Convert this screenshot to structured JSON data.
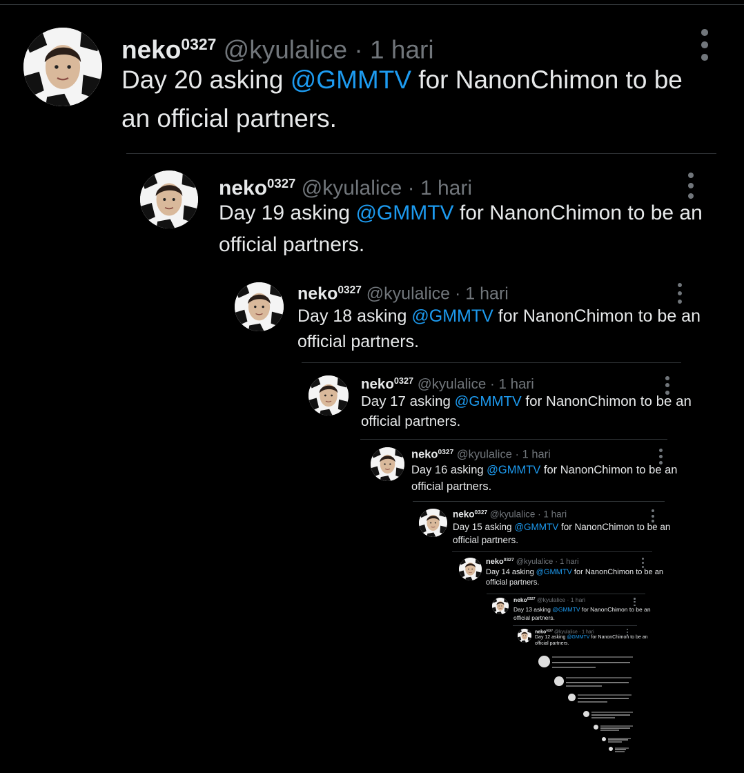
{
  "tweets": [
    {
      "name": "neko",
      "sup": "0327",
      "handle": "@kyulalice",
      "sep": "·",
      "time": "1 hari",
      "pre": "Day 20 asking ",
      "mention": "@GMMTV",
      "post": " for NanonChimon to be an official partners."
    },
    {
      "name": "neko",
      "sup": "0327",
      "handle": "@kyulalice",
      "sep": "·",
      "time": "1 hari",
      "pre": "Day 19 asking ",
      "mention": "@GMMTV",
      "post": " for NanonChimon to be an official partners."
    },
    {
      "name": "neko",
      "sup": "0327",
      "handle": "@kyulalice",
      "sep": "·",
      "time": "1 hari",
      "pre": "Day 18 asking ",
      "mention": "@GMMTV",
      "post": " for NanonChimon to be an official partners."
    },
    {
      "name": "neko",
      "sup": "0327",
      "handle": "@kyulalice",
      "sep": "·",
      "time": "1 hari",
      "pre": "Day 17 asking ",
      "mention": "@GMMTV",
      "post": " for NanonChimon to be an official partners."
    },
    {
      "name": "neko",
      "sup": "0327",
      "handle": "@kyulalice",
      "sep": "·",
      "time": "1 hari",
      "pre": "Day 16 asking ",
      "mention": "@GMMTV",
      "post": " for NanonChimon to be an official partners."
    },
    {
      "name": "neko",
      "sup": "0327",
      "handle": "@kyulalice",
      "sep": "·",
      "time": "1 hari",
      "pre": "Day 15 asking ",
      "mention": "@GMMTV",
      "post": " for NanonChimon to be an official partners."
    },
    {
      "name": "neko",
      "sup": "0327",
      "handle": "@kyulalice",
      "sep": "·",
      "time": "1 hari",
      "pre": "Day 14 asking ",
      "mention": "@GMMTV",
      "post": " for NanonChimon to be an official partners."
    },
    {
      "name": "neko",
      "sup": "0327",
      "handle": "@kyulalice",
      "sep": "·",
      "time": "1 hari",
      "pre": "Day 13 asking ",
      "mention": "@GMMTV",
      "post": " for NanonChimon to be an official partners."
    },
    {
      "name": "neko",
      "sup": "0327",
      "handle": "@kyulalice",
      "sep": "·",
      "time": "1 hari",
      "pre": "Day 12 asking ",
      "mention": "@GMMTV",
      "post": " for NanonChimon to be an official partners."
    }
  ],
  "icons": {
    "avatar": "avatar-image",
    "more": "more-options-icon"
  },
  "colors": {
    "background": "#000000",
    "text": "#e7e9ea",
    "muted": "#71767b",
    "link": "#1d9bf0",
    "divider": "#2f3336"
  }
}
